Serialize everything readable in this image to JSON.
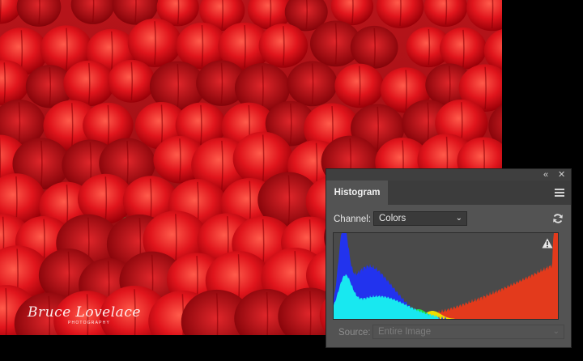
{
  "photo": {
    "subject": "field of red tulips",
    "watermark_name": "Bruce Lovelace",
    "watermark_sub": "PHOTOGRAPHY"
  },
  "panel": {
    "collapse_glyph": "«",
    "close_glyph": "✕",
    "tab_title": "Histogram",
    "channel_label": "Channel:",
    "channel_value": "Colors",
    "source_label": "Source:",
    "source_value": "Entire Image",
    "icons": [
      "collapse-icon",
      "close-icon",
      "panel-menu-icon",
      "refresh-icon",
      "warning-icon",
      "chevron-down-icon"
    ]
  },
  "colors": {
    "tulip_red": "#d8141c",
    "panel_bg": "#535353",
    "hist_blue": "#2233ee",
    "hist_cyan": "#18e8f0",
    "hist_red": "#e33a1c",
    "hist_green": "#22dd33",
    "hist_yellow": "#eedd00"
  }
}
